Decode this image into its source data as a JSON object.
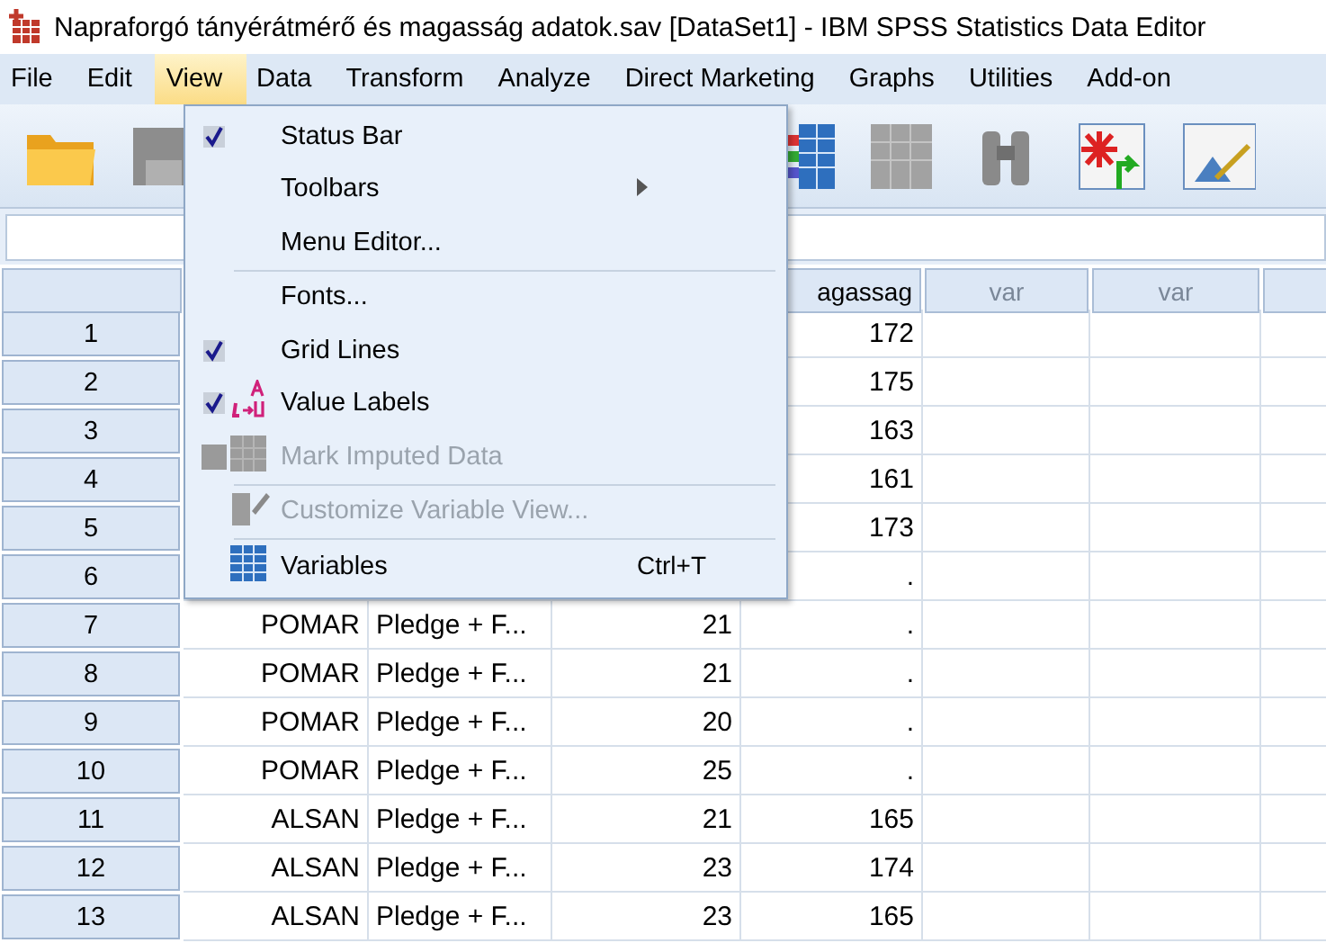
{
  "window": {
    "title": "Napraforgó tányérátmérő és magasság adatok.sav [DataSet1] - IBM SPSS Statistics Data Editor"
  },
  "menubar": [
    {
      "label": "File",
      "selected": false
    },
    {
      "label": "Edit",
      "selected": false
    },
    {
      "label": "View",
      "selected": true
    },
    {
      "label": "Data",
      "selected": false
    },
    {
      "label": "Transform",
      "selected": false
    },
    {
      "label": "Analyze",
      "selected": false
    },
    {
      "label": "Direct Marketing",
      "selected": false
    },
    {
      "label": "Graphs",
      "selected": false
    },
    {
      "label": "Utilities",
      "selected": false
    },
    {
      "label": "Add-on",
      "selected": false
    }
  ],
  "view_menu": {
    "sections": [
      [
        {
          "label": "Status Bar",
          "kind": "toggle",
          "checked": true,
          "disabled": false
        },
        {
          "label": "Toolbars",
          "kind": "submenu",
          "disabled": false
        },
        {
          "label": "Menu Editor...",
          "kind": "plain",
          "disabled": false
        }
      ],
      [
        {
          "label": "Fonts...",
          "kind": "plain",
          "disabled": false
        },
        {
          "label": "Grid Lines",
          "kind": "toggle",
          "checked": true,
          "disabled": false
        },
        {
          "label": "Value Labels",
          "kind": "toggle",
          "checked": true,
          "disabled": false
        },
        {
          "label": "Mark Imputed Data",
          "kind": "toggle",
          "checked": false,
          "disabled": true
        }
      ],
      [
        {
          "label": "Customize Variable View...",
          "kind": "plain",
          "disabled": true
        }
      ],
      [
        {
          "label": "Variables",
          "kind": "plain",
          "disabled": false,
          "shortcut": "Ctrl+T"
        }
      ]
    ]
  },
  "grid": {
    "columns": [
      "agassag",
      "var",
      "var"
    ],
    "rows": [
      {
        "number": "1",
        "cells": [
          "172"
        ]
      },
      {
        "number": "2",
        "cells": [
          "175"
        ]
      },
      {
        "number": "3",
        "cells": [
          "163"
        ]
      },
      {
        "number": "4",
        "cells": [
          "161"
        ]
      },
      {
        "number": "5",
        "cells": [
          "173"
        ]
      },
      {
        "number": "6",
        "cells": [
          "."
        ]
      },
      {
        "number": "7",
        "cells": [
          "POMAR",
          "Pledge + F...",
          "21",
          "."
        ]
      },
      {
        "number": "8",
        "cells": [
          "POMAR",
          "Pledge + F...",
          "21",
          "."
        ]
      },
      {
        "number": "9",
        "cells": [
          "POMAR",
          "Pledge + F...",
          "20",
          "."
        ]
      },
      {
        "number": "10",
        "cells": [
          "POMAR",
          "Pledge + F...",
          "25",
          "."
        ]
      },
      {
        "number": "11",
        "cells": [
          "ALSAN",
          "Pledge + F...",
          "21",
          "165"
        ]
      },
      {
        "number": "12",
        "cells": [
          "ALSAN",
          "Pledge + F...",
          "23",
          "174"
        ]
      },
      {
        "number": "13",
        "cells": [
          "ALSAN",
          "Pledge + F...",
          "23",
          "165"
        ]
      }
    ]
  }
}
